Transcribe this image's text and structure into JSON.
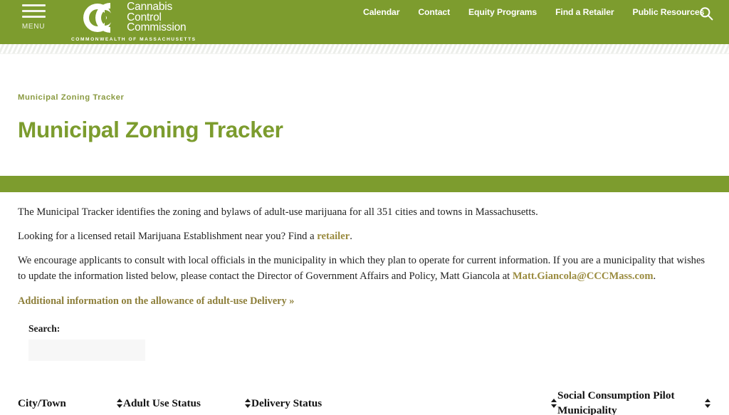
{
  "header": {
    "menu_label": "MENU",
    "menu_icon": "hamburger-icon",
    "logo": {
      "line1": "Cannabis",
      "line2": "Control",
      "line3": "Commission",
      "subtitle": "COMMONWEALTH OF MASSACHUSETTS",
      "mark_icon": "interlocking-c-logo-icon"
    },
    "nav": [
      {
        "label": "Calendar"
      },
      {
        "label": "Contact"
      },
      {
        "label": "Equity Programs"
      },
      {
        "label": "Find a Retailer"
      },
      {
        "label": "Public Resources"
      }
    ],
    "search_icon": "search-icon",
    "bar_color": "#7d9c2e"
  },
  "page": {
    "breadcrumb": "Municipal Zoning Tracker",
    "title": "Municipal Zoning Tracker",
    "title_color": "#7c9c2e",
    "divider_color": "#7d9c2e"
  },
  "content": {
    "paragraph1": "The Municipal Tracker identifies the zoning and bylaws of adult-use marijuana for all 351 cities and towns in Massachusetts.",
    "paragraph2_before": "Looking for a licensed retail Marijuana Establishment near you? Find a ",
    "paragraph2_link": "retailer",
    "paragraph2_after": ".",
    "paragraph3_before": "We encourage applicants to consult with local officials in the municipality in which they plan to operate for current information. If you are a municipality that wishes to update the information listed below, please contact the Director of Government Affairs and Policy, Matt Giancola at ",
    "paragraph3_link": "Matt.Giancola@CCCMass.com",
    "paragraph3_after": ".",
    "delivery_link": "Additional information on the allowance of adult-use Delivery »",
    "link_color": "#9a8b3f"
  },
  "filters": {
    "search_label": "Search:",
    "search_value": "",
    "search_placeholder": ""
  },
  "table": {
    "columns": [
      {
        "label": "City/Town",
        "sort_icon": "sort-both-icon"
      },
      {
        "label": "Adult Use Status",
        "sort_icon": "sort-both-icon"
      },
      {
        "label": "Delivery Status",
        "sort_icon": "sort-both-icon"
      },
      {
        "label": "Social Consumption Pilot Municipality",
        "sort_icon": "sort-both-icon"
      }
    ],
    "rows": []
  }
}
